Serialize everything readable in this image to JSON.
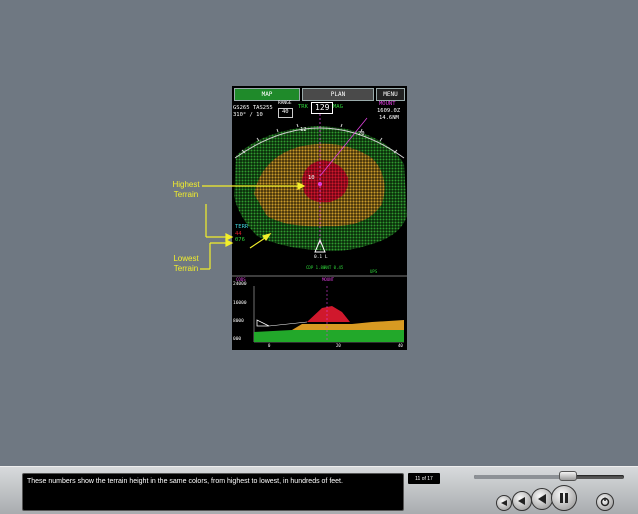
{
  "display": {
    "tabs": {
      "map": "MAP",
      "plan": "PLAN",
      "menu": "MENU"
    },
    "gs": "GS265",
    "tas": "TAS255",
    "wind": "310° / 10",
    "range_label": "RANGE",
    "range_value": "40",
    "trk_label": "TRK",
    "heading": "129",
    "mag_label": "MAG",
    "waypoint_name": "MOUNT",
    "waypoint_time": "1609.0Z",
    "waypoint_dist": "14.6NM",
    "scale_left": "12",
    "scale_right": "20",
    "scale_center": "10",
    "terr_label": "TERR",
    "terr_high": "44",
    "terr_low": "076",
    "aircraft_mark": "0.1 L",
    "profile_labels": {
      "cdp": "CDP",
      "cdp_value": "1.88",
      "ant": "ANT",
      "ant_value": "0.45",
      "ups": "UPS",
      "vsd_left": "CODS",
      "vsd_waypoint": "MOUNT"
    },
    "altitudes": [
      "24000",
      "16000",
      "8000",
      "000"
    ],
    "distances": [
      "0",
      "20",
      "40"
    ]
  },
  "callouts": {
    "highest": "Highest\nTerrain",
    "lowest": "Lowest\nTerrain"
  },
  "controls": {
    "caption": "These numbers show the terrain height in the same colors, from highest to lowest, in hundreds of feet.",
    "page_counter": "11 of 17",
    "progress": 0.62
  },
  "colors": {
    "background": "#6f7882",
    "callout": "#f3ef2a",
    "terrain_high": "#c8162a",
    "terrain_mid": "#c89a2a",
    "terrain_low": "#2f9a2f"
  }
}
